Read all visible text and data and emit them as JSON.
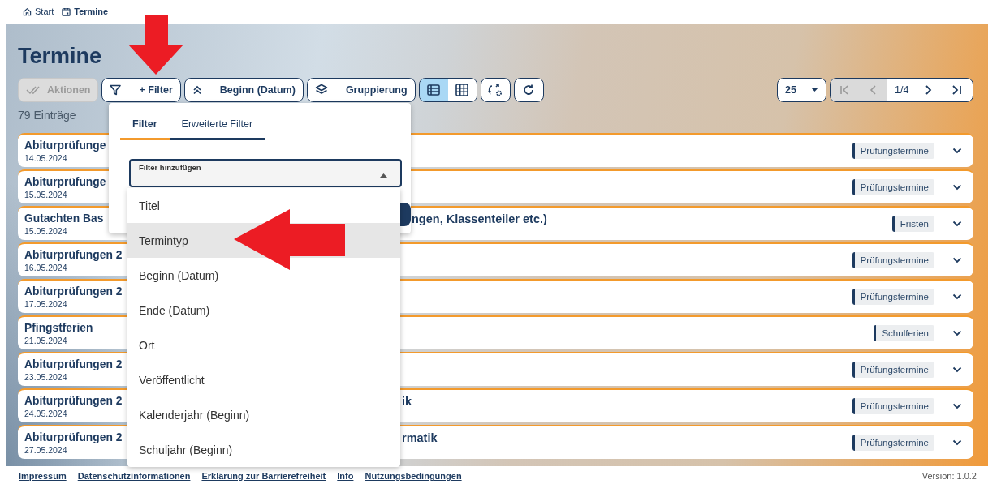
{
  "breadcrumb": [
    {
      "label": "Start",
      "kind": "home",
      "current": false
    },
    {
      "label": "Termine",
      "kind": "calendar",
      "current": true
    }
  ],
  "title": "Termine",
  "toolbar": {
    "actions": {
      "label": "Aktionen",
      "disabled": true
    },
    "filter": {
      "label": "+ Filter"
    },
    "sort": {
      "label": "Beginn (Datum)"
    },
    "group": {
      "label": "Gruppierung"
    },
    "views": [
      {
        "kind": "list",
        "selected": true
      },
      {
        "kind": "grid",
        "selected": false
      }
    ]
  },
  "pagination": {
    "page_size": "25",
    "page": "1/4",
    "buttons": [
      {
        "kind": "first",
        "disabled": true
      },
      {
        "kind": "prev",
        "disabled": true
      },
      {
        "kind": "next",
        "disabled": false
      },
      {
        "kind": "last",
        "disabled": false
      }
    ]
  },
  "count": "79 Einträge",
  "rows": [
    {
      "title": "Abiturprüfunge",
      "date": "14.05.2024",
      "tag": "Prüfungstermine"
    },
    {
      "title": "Abiturprüfunge",
      "date": "15.05.2024",
      "tag": "Prüfungstermine"
    },
    {
      "title": "Gutachten Bas",
      "title_tail": "ngen, Klassenteiler etc.)",
      "date": "15.05.2024",
      "tag": "Fristen"
    },
    {
      "title": "Abiturprüfungen 2",
      "date": "16.05.2024",
      "tag": "Prüfungstermine"
    },
    {
      "title": "Abiturprüfungen 2",
      "date": "17.05.2024",
      "tag": "Prüfungstermine"
    },
    {
      "title": "Pfingstferien",
      "date": "21.05.2024",
      "tag": "Schulferien"
    },
    {
      "title": "Abiturprüfungen 2",
      "date": "23.05.2024",
      "tag": "Prüfungstermine"
    },
    {
      "title": "Abiturprüfungen 2",
      "title_tail": "ik",
      "date": "24.05.2024",
      "tag": "Prüfungstermine"
    },
    {
      "title": "Abiturprüfungen 2",
      "title_tail": "rmatik",
      "date": "27.05.2024",
      "tag": "Prüfungstermine"
    }
  ],
  "filter_popover": {
    "tabs": [
      {
        "label": "Filter",
        "selected": true
      },
      {
        "label": "Erweiterte Filter",
        "selected": false
      }
    ],
    "select": {
      "label": "Filter hinzufügen",
      "expanded": true
    },
    "options": [
      {
        "label": "Titel",
        "selected": false
      },
      {
        "label": "Termintyp",
        "selected": true
      },
      {
        "label": "Beginn (Datum)",
        "selected": false
      },
      {
        "label": "Ende (Datum)",
        "selected": false
      },
      {
        "label": "Ort",
        "selected": false
      },
      {
        "label": "Veröffentlicht",
        "selected": false
      },
      {
        "label": "Kalenderjahr (Beginn)",
        "selected": false
      },
      {
        "label": "Schuljahr (Beginn)",
        "selected": false
      }
    ]
  },
  "footer": {
    "links": [
      "Impressum",
      "Datenschutzinformationen",
      "Erklärung zur Barrierefreiheit",
      "Info",
      "Nutzungsbedingungen"
    ],
    "version": "Version: 1.0.2"
  }
}
